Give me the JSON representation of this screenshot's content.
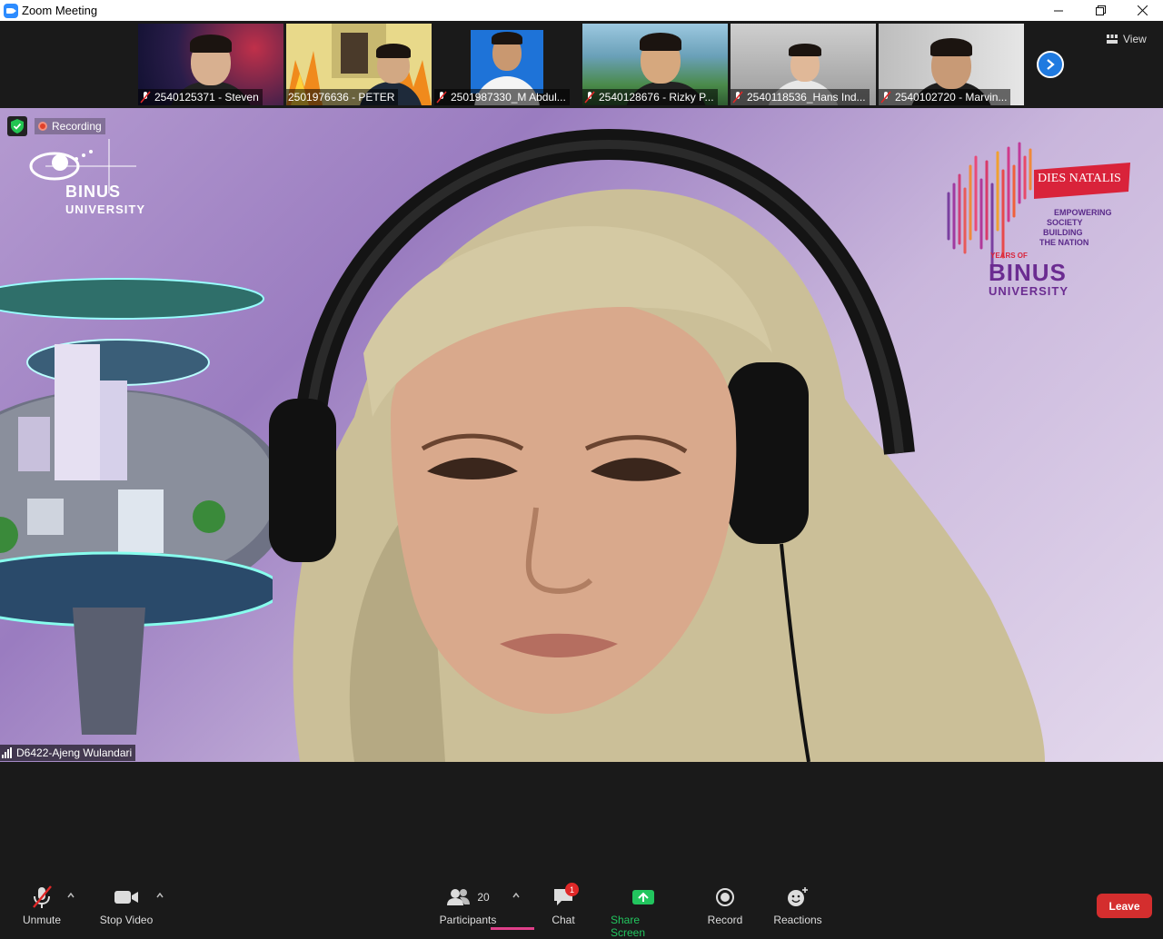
{
  "window": {
    "title": "Zoom Meeting",
    "controls": [
      "minimize-icon",
      "restore-icon",
      "close-icon"
    ]
  },
  "thumbnails": [
    {
      "name": "2540125371 - Steven",
      "muted": true,
      "bg": "#2a1d4a"
    },
    {
      "name": "2501976636 - PETER",
      "muted": false,
      "bg": "#e8d98a"
    },
    {
      "name": "2501987330_M Abdul...",
      "muted": true,
      "bg": "#ffffff"
    },
    {
      "name": "2540128676 - Rizky P...",
      "muted": true,
      "bg": "#7fb6cf"
    },
    {
      "name": "2540118536_Hans Ind...",
      "muted": true,
      "bg": "#bcbcbc"
    },
    {
      "name": "2540102720 - Marvin...",
      "muted": true,
      "bg": "#d9d9d9"
    }
  ],
  "view_label": "View",
  "speaker": {
    "name": "D6422-Ajeng Wulandari",
    "recording_label": "Recording"
  },
  "branding": {
    "binus_top": "BINUS",
    "binus_bottom": "UNIVERSITY",
    "dies_natalis": "DIES NATALIS",
    "tagline": [
      "EMPOWERING",
      "SOCIETY",
      "BUILDING",
      "THE NATION"
    ],
    "years_of": "YEARS OF",
    "binus2_top": "BINUS",
    "binus2_bottom": "UNIVERSITY"
  },
  "toolbar": {
    "unmute": "Unmute",
    "stop_video": "Stop Video",
    "participants": "Participants",
    "participants_count": "20",
    "chat": "Chat",
    "chat_badge": "1",
    "share_screen": "Share Screen",
    "record": "Record",
    "reactions": "Reactions",
    "leave": "Leave"
  },
  "colors": {
    "share_green": "#22c55e",
    "leave_red": "#d42e2e",
    "zoom_blue": "#2d8cff",
    "binus_purple": "#6b2c91"
  }
}
